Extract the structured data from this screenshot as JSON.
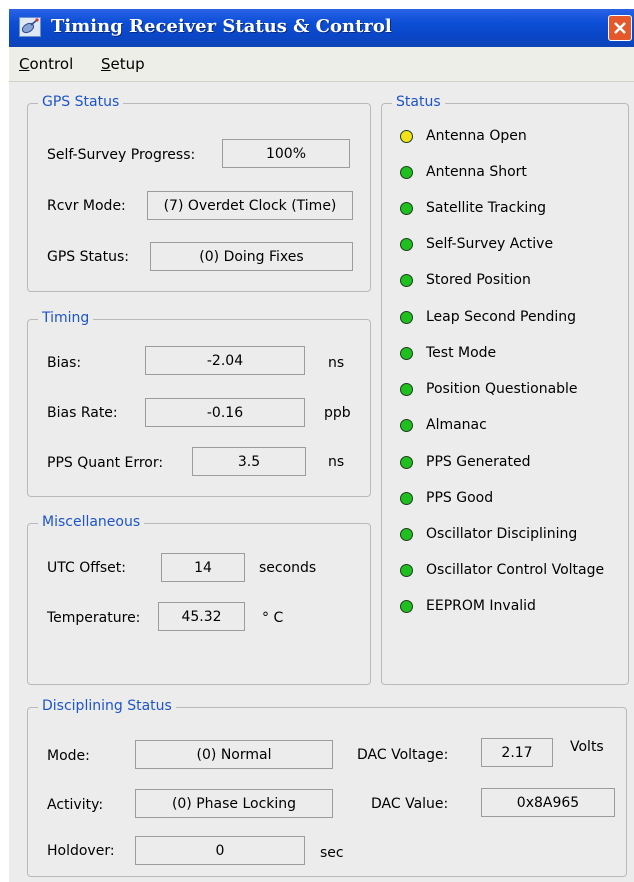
{
  "window": {
    "title": "Timing Receiver Status & Control"
  },
  "menu": {
    "control": "Control",
    "setup": "Setup"
  },
  "gps_status": {
    "legend": "GPS Status",
    "self_survey_label": "Self-Survey Progress:",
    "self_survey_value": "100%",
    "rcvr_mode_label": "Rcvr Mode:",
    "rcvr_mode_value": "(7) Overdet Clock (Time)",
    "gps_status_label": "GPS Status:",
    "gps_status_value": "(0) Doing Fixes"
  },
  "timing": {
    "legend": "Timing",
    "bias_label": "Bias:",
    "bias_value": "-2.04",
    "bias_unit": "ns",
    "bias_rate_label": "Bias Rate:",
    "bias_rate_value": "-0.16",
    "bias_rate_unit": "ppb",
    "pps_label": "PPS Quant Error:",
    "pps_value": "3.5",
    "pps_unit": "ns"
  },
  "misc": {
    "legend": "Miscellaneous",
    "utc_label": "UTC Offset:",
    "utc_value": "14",
    "utc_unit": "seconds",
    "temp_label": "Temperature:",
    "temp_value": "45.32",
    "temp_unit": "° C"
  },
  "status": {
    "legend": "Status",
    "colors": {
      "yellow": "#f3e21a",
      "green": "#1fbf1f"
    },
    "items": [
      {
        "label": "Antenna Open",
        "state": "yellow"
      },
      {
        "label": "Antenna Short",
        "state": "green"
      },
      {
        "label": "Satellite Tracking",
        "state": "green"
      },
      {
        "label": "Self-Survey Active",
        "state": "green"
      },
      {
        "label": "Stored Position",
        "state": "green"
      },
      {
        "label": "Leap Second Pending",
        "state": "green"
      },
      {
        "label": "Test Mode",
        "state": "green"
      },
      {
        "label": "Position Questionable",
        "state": "green"
      },
      {
        "label": "Almanac",
        "state": "green"
      },
      {
        "label": "PPS Generated",
        "state": "green"
      },
      {
        "label": "PPS Good",
        "state": "green"
      },
      {
        "label": "Oscillator Disciplining",
        "state": "green"
      },
      {
        "label": "Oscillator Control Voltage",
        "state": "green"
      },
      {
        "label": "EEPROM Invalid",
        "state": "green"
      }
    ]
  },
  "disciplining": {
    "legend": "Disciplining Status",
    "mode_label": "Mode:",
    "mode_value": "(0) Normal",
    "activity_label": "Activity:",
    "activity_value": "(0) Phase Locking",
    "holdover_label": "Holdover:",
    "holdover_value": "0",
    "holdover_unit": "sec",
    "dac_voltage_label": "DAC Voltage:",
    "dac_voltage_value": "2.17",
    "dac_voltage_unit": "Volts",
    "dac_value_label": "DAC Value:",
    "dac_value_value": "0x8A965"
  }
}
